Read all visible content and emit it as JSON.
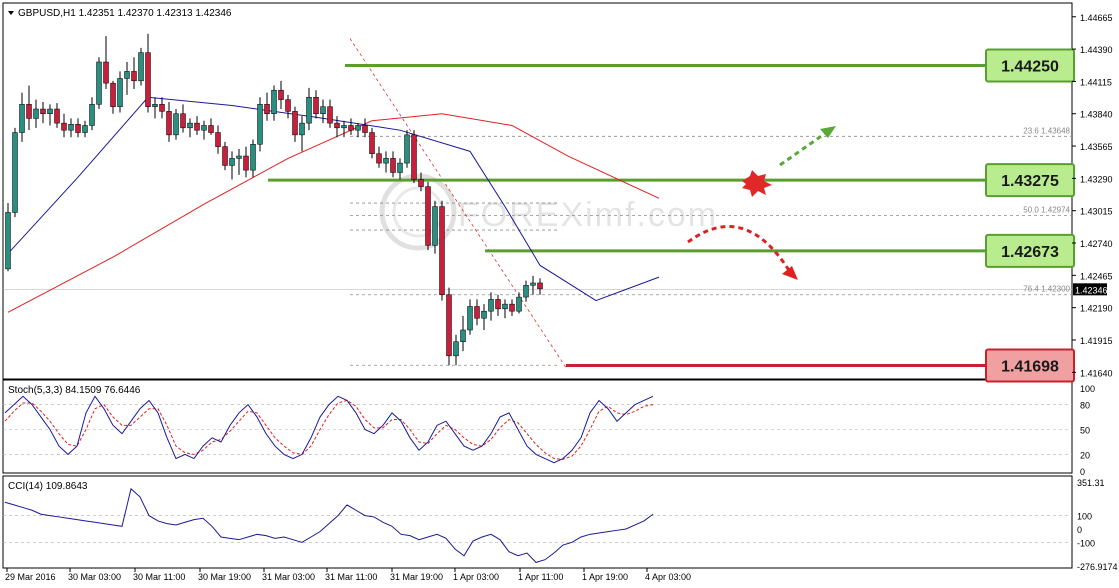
{
  "chart_data": {
    "type": "candlestick",
    "symbol_header": "GBPUSD,H1  1.42351 1.42370 1.42313 1.42346",
    "current_price_label": "1.42346",
    "price_ticks": [
      "1.44665",
      "1.44390",
      "1.44115",
      "1.43840",
      "1.43565",
      "1.43290",
      "1.43015",
      "1.42740",
      "1.42465",
      "1.42190",
      "1.41915",
      "1.41640"
    ],
    "price_ylim": [
      1.415,
      1.448
    ],
    "time_labels": [
      "29 Mar 2016",
      "30 Mar 03:00",
      "30 Mar 11:00",
      "30 Mar 19:00",
      "31 Mar 03:00",
      "31 Mar 11:00",
      "31 Mar 19:00",
      "1 Apr 03:00",
      "1 Apr 11:00",
      "1 Apr 19:00",
      "4 Apr 03:00"
    ],
    "levels": [
      {
        "label": "1.44250",
        "value": 1.4425,
        "color": "#5a9e2f",
        "box": "#b9ec8f"
      },
      {
        "label": "1.43275",
        "value": 1.43275,
        "color": "#5a9e2f",
        "box": "#b9ec8f"
      },
      {
        "label": "1.42673",
        "value": 1.42673,
        "color": "#5a9e2f",
        "box": "#b9ec8f"
      },
      {
        "label": "1.41698",
        "value": 1.41698,
        "color": "#c8202c",
        "box": "#f0a0a0"
      }
    ],
    "fibonacci": [
      {
        "label": "23.6  1.43648",
        "value": 1.43648
      },
      {
        "label": "50.0  1.42974",
        "value": 1.42974
      },
      {
        "label": "76.4  1.42300",
        "value": 1.423
      }
    ],
    "candles": [
      [
        1.4252,
        1.4308,
        1.425,
        1.43
      ],
      [
        1.43,
        1.4372,
        1.4296,
        1.4368
      ],
      [
        1.4368,
        1.4402,
        1.436,
        1.4392
      ],
      [
        1.4392,
        1.4408,
        1.437,
        1.438
      ],
      [
        1.438,
        1.4396,
        1.4372,
        1.4388
      ],
      [
        1.4388,
        1.4394,
        1.4376,
        1.4384
      ],
      [
        1.4384,
        1.4392,
        1.4374,
        1.4388
      ],
      [
        1.4388,
        1.4393,
        1.4372,
        1.4376
      ],
      [
        1.4376,
        1.4384,
        1.4364,
        1.437
      ],
      [
        1.437,
        1.438,
        1.4364,
        1.4375
      ],
      [
        1.4375,
        1.438,
        1.4364,
        1.4368
      ],
      [
        1.4368,
        1.4378,
        1.4364,
        1.4374
      ],
      [
        1.4374,
        1.4398,
        1.437,
        1.4392
      ],
      [
        1.4392,
        1.4432,
        1.4388,
        1.4428
      ],
      [
        1.4428,
        1.445,
        1.4405,
        1.441
      ],
      [
        1.441,
        1.4412,
        1.4384,
        1.439
      ],
      [
        1.439,
        1.442,
        1.4385,
        1.4414
      ],
      [
        1.4414,
        1.4428,
        1.44,
        1.442
      ],
      [
        1.442,
        1.4432,
        1.4405,
        1.4412
      ],
      [
        1.4412,
        1.444,
        1.4408,
        1.4436
      ],
      [
        1.4436,
        1.4452,
        1.4385,
        1.439
      ],
      [
        1.439,
        1.4398,
        1.438,
        1.4392
      ],
      [
        1.4392,
        1.4398,
        1.438,
        1.4386
      ],
      [
        1.4386,
        1.4394,
        1.436,
        1.4366
      ],
      [
        1.4366,
        1.4388,
        1.4362,
        1.4384
      ],
      [
        1.4384,
        1.4392,
        1.4368,
        1.4372
      ],
      [
        1.4372,
        1.438,
        1.4364,
        1.4376
      ],
      [
        1.4376,
        1.4382,
        1.4366,
        1.437
      ],
      [
        1.437,
        1.4378,
        1.4362,
        1.4374
      ],
      [
        1.4374,
        1.438,
        1.4366,
        1.4368
      ],
      [
        1.4368,
        1.4374,
        1.435,
        1.4356
      ],
      [
        1.4356,
        1.436,
        1.4336,
        1.434
      ],
      [
        1.434,
        1.4352,
        1.4328,
        1.4346
      ],
      [
        1.4346,
        1.4354,
        1.4332,
        1.4348
      ],
      [
        1.4348,
        1.4356,
        1.433,
        1.4336
      ],
      [
        1.4336,
        1.4362,
        1.433,
        1.4358
      ],
      [
        1.4358,
        1.4398,
        1.4352,
        1.4392
      ],
      [
        1.4392,
        1.4402,
        1.4378,
        1.4384
      ],
      [
        1.4384,
        1.4408,
        1.4378,
        1.4404
      ],
      [
        1.4404,
        1.4412,
        1.4388,
        1.4396
      ],
      [
        1.4396,
        1.44,
        1.438,
        1.4386
      ],
      [
        1.4386,
        1.439,
        1.436,
        1.4366
      ],
      [
        1.4366,
        1.4382,
        1.4352,
        1.4376
      ],
      [
        1.4376,
        1.4406,
        1.437,
        1.4398
      ],
      [
        1.4398,
        1.4404,
        1.438,
        1.4384
      ],
      [
        1.4384,
        1.4396,
        1.4376,
        1.439
      ],
      [
        1.439,
        1.4396,
        1.4372,
        1.4376
      ],
      [
        1.4376,
        1.4382,
        1.4364,
        1.4372
      ],
      [
        1.4372,
        1.4378,
        1.4364,
        1.4374
      ],
      [
        1.4374,
        1.438,
        1.4366,
        1.437
      ],
      [
        1.437,
        1.4376,
        1.4364,
        1.4374
      ],
      [
        1.4374,
        1.438,
        1.4364,
        1.4368
      ],
      [
        1.4368,
        1.4372,
        1.4346,
        1.435
      ],
      [
        1.435,
        1.4356,
        1.4338,
        1.4342
      ],
      [
        1.4342,
        1.4352,
        1.4334,
        1.4346
      ],
      [
        1.4346,
        1.4352,
        1.433,
        1.4334
      ],
      [
        1.4334,
        1.4346,
        1.4328,
        1.4342
      ],
      [
        1.4342,
        1.437,
        1.4338,
        1.4366
      ],
      [
        1.4366,
        1.437,
        1.4325,
        1.4328
      ],
      [
        1.4328,
        1.4334,
        1.4318,
        1.4322
      ],
      [
        1.4322,
        1.4326,
        1.4268,
        1.4272
      ],
      [
        1.4272,
        1.431,
        1.4265,
        1.4305
      ],
      [
        1.4305,
        1.431,
        1.4225,
        1.423
      ],
      [
        1.423,
        1.4236,
        1.417,
        1.4178
      ],
      [
        1.4178,
        1.4196,
        1.417,
        1.419
      ],
      [
        1.419,
        1.4212,
        1.4182,
        1.42
      ],
      [
        1.42,
        1.4226,
        1.4196,
        1.422
      ],
      [
        1.422,
        1.4226,
        1.4204,
        1.421
      ],
      [
        1.421,
        1.4222,
        1.42,
        1.4216
      ],
      [
        1.4216,
        1.4232,
        1.4208,
        1.4226
      ],
      [
        1.4226,
        1.423,
        1.4212,
        1.4218
      ],
      [
        1.4218,
        1.4226,
        1.421,
        1.4222
      ],
      [
        1.4222,
        1.4226,
        1.4212,
        1.4216
      ],
      [
        1.4216,
        1.4232,
        1.4214,
        1.4228
      ],
      [
        1.4228,
        1.4242,
        1.4224,
        1.4238
      ],
      [
        1.4238,
        1.4246,
        1.423,
        1.424
      ],
      [
        1.424,
        1.4244,
        1.423,
        1.4235
      ]
    ],
    "ma_fast": [
      [
        0,
        1.4265
      ],
      [
        10,
        1.433
      ],
      [
        20,
        1.4398
      ],
      [
        32,
        1.4391
      ],
      [
        44,
        1.4381
      ],
      [
        56,
        1.437
      ],
      [
        66,
        1.4352
      ],
      [
        71,
        1.4305
      ],
      [
        76,
        1.4255
      ],
      [
        84,
        1.4225
      ],
      [
        93,
        1.4245
      ]
    ],
    "ma_slow": [
      [
        0,
        1.4215
      ],
      [
        15,
        1.4262
      ],
      [
        28,
        1.4307
      ],
      [
        40,
        1.4346
      ],
      [
        52,
        1.4378
      ],
      [
        62,
        1.4384
      ],
      [
        72,
        1.4374
      ],
      [
        80,
        1.4348
      ],
      [
        93,
        1.4312
      ]
    ],
    "stochastic": {
      "label": "Stoch(5,3,3) 84.1509 76.6446",
      "ticks": [
        "100",
        "80",
        "50",
        "20",
        "0"
      ],
      "k": [
        70,
        80,
        90,
        80,
        65,
        50,
        30,
        20,
        30,
        70,
        90,
        75,
        55,
        45,
        60,
        75,
        85,
        70,
        40,
        15,
        20,
        15,
        30,
        40,
        35,
        55,
        70,
        80,
        65,
        45,
        30,
        20,
        15,
        20,
        40,
        65,
        80,
        90,
        85,
        70,
        50,
        45,
        55,
        70,
        60,
        40,
        25,
        35,
        55,
        60,
        45,
        30,
        25,
        30,
        45,
        65,
        70,
        50,
        30,
        20,
        15,
        10,
        15,
        25,
        40,
        70,
        85,
        75,
        60,
        70,
        80,
        85,
        90
      ],
      "d": [
        60,
        72,
        82,
        82,
        72,
        60,
        45,
        32,
        30,
        50,
        75,
        80,
        65,
        55,
        55,
        65,
        75,
        75,
        55,
        30,
        22,
        20,
        25,
        35,
        38,
        48,
        60,
        72,
        70,
        55,
        40,
        30,
        22,
        20,
        30,
        50,
        68,
        82,
        85,
        78,
        62,
        52,
        52,
        62,
        62,
        50,
        35,
        33,
        45,
        55,
        50,
        40,
        32,
        30,
        38,
        52,
        62,
        58,
        45,
        32,
        22,
        15,
        14,
        18,
        30,
        50,
        72,
        78,
        70,
        68,
        72,
        78,
        80
      ]
    },
    "cci": {
      "label": "CCI(14) 109.8643",
      "ticks": [
        "351.31",
        "100",
        "0",
        "-100",
        "-276.9174"
      ],
      "values": [
        200,
        180,
        160,
        140,
        110,
        100,
        90,
        80,
        70,
        60,
        50,
        40,
        30,
        20,
        300,
        240,
        100,
        60,
        40,
        30,
        50,
        70,
        80,
        20,
        -60,
        -70,
        -80,
        -60,
        -40,
        -50,
        -70,
        -60,
        -80,
        -100,
        -60,
        -20,
        40,
        100,
        180,
        140,
        100,
        90,
        50,
        20,
        -40,
        -50,
        -80,
        -60,
        -40,
        -70,
        -150,
        -200,
        -90,
        -60,
        -40,
        -80,
        -170,
        -200,
        -180,
        -250,
        -230,
        -180,
        -120,
        -100,
        -60,
        -40,
        -30,
        -20,
        -10,
        0,
        30,
        60,
        110
      ]
    }
  },
  "watermark": "FOREXimf.com"
}
